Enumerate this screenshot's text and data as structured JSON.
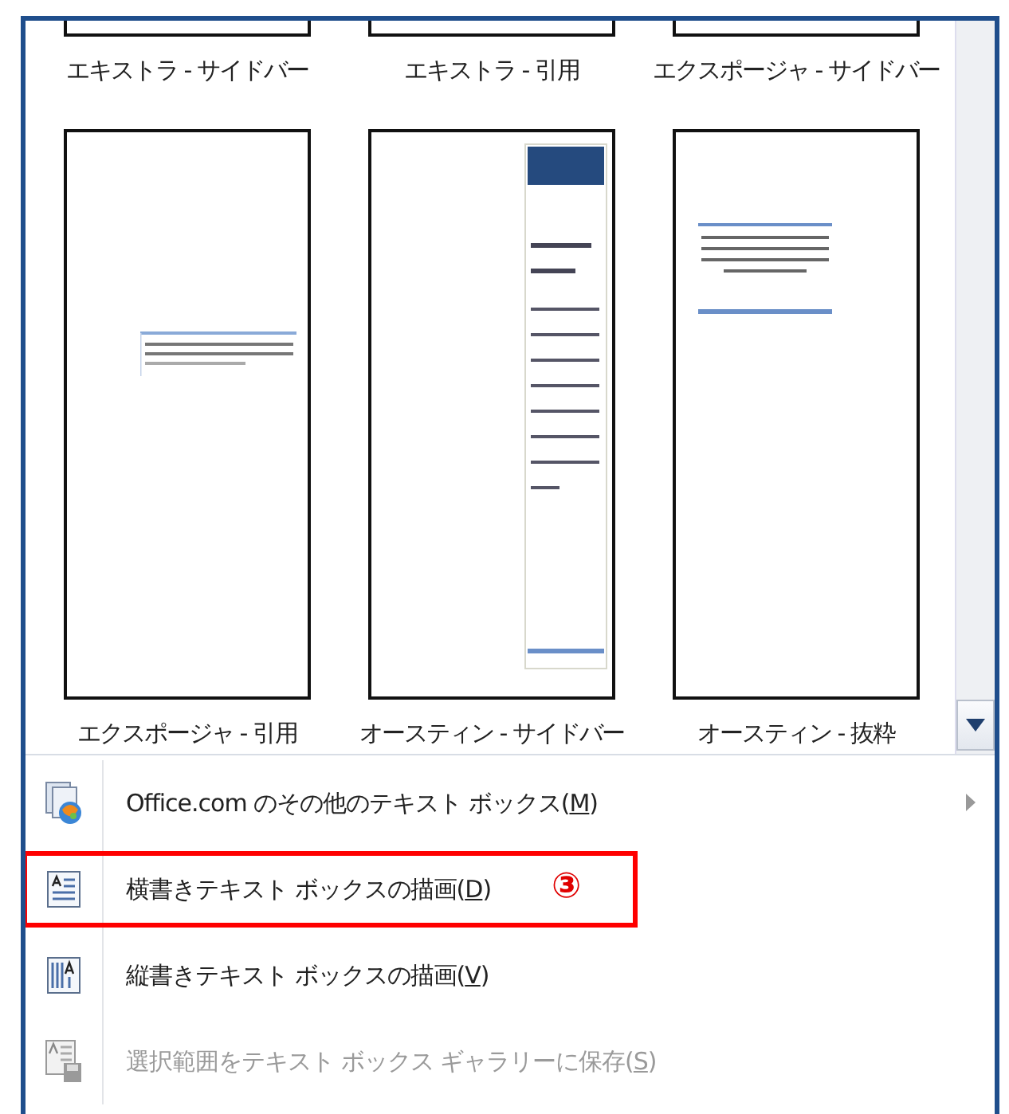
{
  "gallery": {
    "items": [
      {
        "label": "エキストラ - サイドバー",
        "kind": "cut"
      },
      {
        "label": "エキストラ - 引用",
        "kind": "cut"
      },
      {
        "label": "エクスポージャ - サイドバー",
        "kind": "cut"
      },
      {
        "label": "エクスポージャ - 引用",
        "kind": "quote"
      },
      {
        "label": "オースティン - サイドバー",
        "kind": "sidebar"
      },
      {
        "label": "オースティン - 抜粋",
        "kind": "excerpt"
      }
    ]
  },
  "menu": [
    {
      "kind": "office",
      "text": "Office.com のその他のテキスト ボックス(",
      "accel": "M",
      "text_end": ")",
      "disabled": false,
      "has_submenu": true,
      "annotated": false
    },
    {
      "kind": "horizontal",
      "text": "横書きテキスト ボックスの描画(",
      "accel": "D",
      "text_end": ")",
      "disabled": false,
      "has_submenu": false,
      "annotated": true,
      "annotation": "③"
    },
    {
      "kind": "vertical",
      "text": "縦書きテキスト ボックスの描画(",
      "accel": "V",
      "text_end": ")",
      "disabled": false,
      "has_submenu": false,
      "annotated": false
    },
    {
      "kind": "save",
      "text": "選択範囲をテキスト ボックス ギャラリーに保存(",
      "accel": "S",
      "text_end": ")",
      "disabled": true,
      "has_submenu": false,
      "annotated": false
    }
  ]
}
